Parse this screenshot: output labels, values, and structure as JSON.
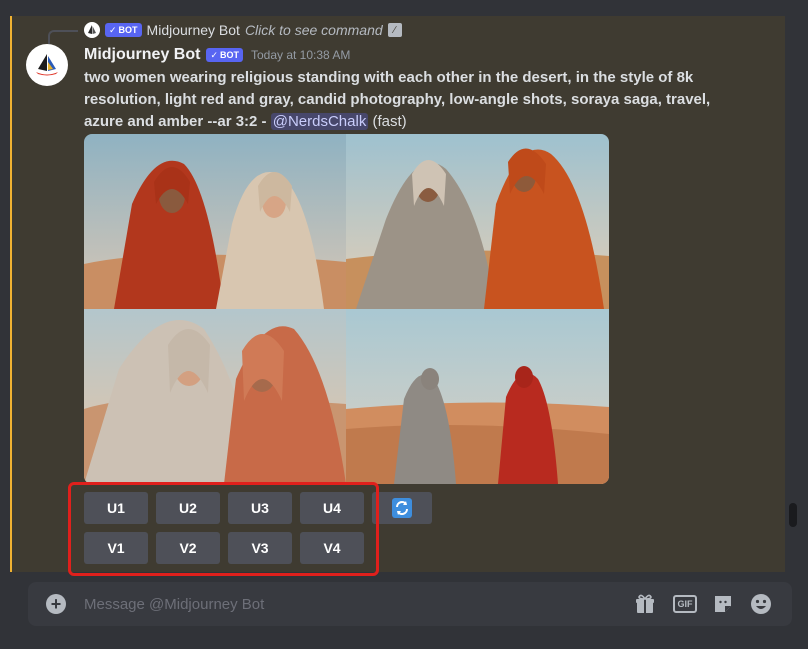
{
  "reply": {
    "bot_tag": "BOT",
    "name": "Midjourney Bot",
    "command_hint": "Click to see command"
  },
  "message": {
    "author": "Midjourney Bot",
    "bot_tag": "BOT",
    "timestamp": "Today at 10:38 AM",
    "prompt_text": "two women wearing religious standing with each other in the desert, in the style of 8k resolution, light red and gray, candid photography, low-angle shots, soraya saga, travel, azure and amber --ar 3:2 - ",
    "mention": "@NerdsChalk",
    "speed": "(fast)"
  },
  "images": [
    {
      "name": "grid-image-1"
    },
    {
      "name": "grid-image-2"
    },
    {
      "name": "grid-image-3"
    },
    {
      "name": "grid-image-4"
    }
  ],
  "buttons": {
    "upscale": [
      "U1",
      "U2",
      "U3",
      "U4"
    ],
    "variation": [
      "V1",
      "V2",
      "V3",
      "V4"
    ],
    "reroll_icon": "refresh-icon"
  },
  "composer": {
    "placeholder": "Message @Midjourney Bot",
    "icons": [
      "gift-icon",
      "gif-icon",
      "sticker-icon",
      "emoji-icon"
    ],
    "gif_label": "GIF"
  },
  "colors": {
    "highlight_band": "#3f3b31",
    "mention_accent": "#f0b232",
    "bot_tag": "#5865f2",
    "annotation_box": "#e0201c"
  }
}
